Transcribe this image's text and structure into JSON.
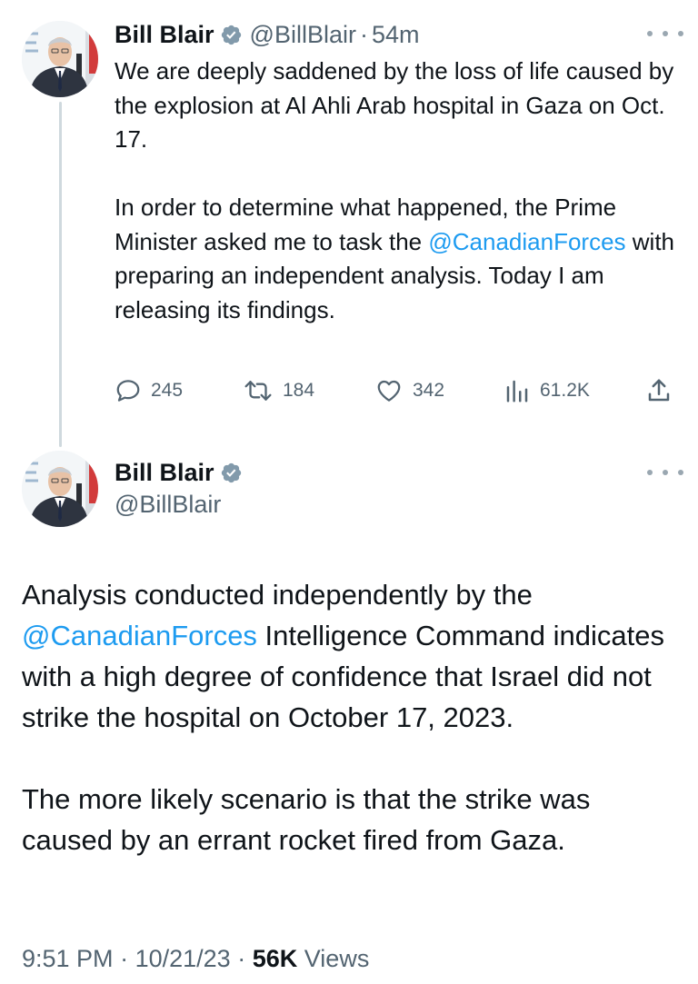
{
  "tweet1": {
    "display_name": "Bill Blair",
    "handle": "@BillBlair",
    "separator": "·",
    "time": "54m",
    "paragraph1": "We are deeply saddened by the loss of life caused by the explosion at Al Ahli Arab hospital in Gaza on Oct. 17.",
    "paragraph2_before": "In order to determine what happened, the Prime Minister asked me to task the ",
    "mention": "@CanadianForces",
    "paragraph2_after": " with preparing an independent analysis. Today I am releasing its findings.",
    "replies": "245",
    "reposts": "184",
    "likes": "342",
    "views": "61.2K"
  },
  "tweet2": {
    "display_name": "Bill Blair",
    "handle": "@BillBlair",
    "paragraph1_before": "Analysis conducted independently by the ",
    "mention": "@CanadianForces",
    "paragraph1_after": " Intelligence Command indicates with a high degree of confidence that Israel did not strike the hospital on October 17, 2023.",
    "paragraph2": "The more likely scenario is that the strike was caused by an errant rocket fired from Gaza.",
    "time": "9:51 PM",
    "separator": "·",
    "date": "10/21/23",
    "views_count": "56K",
    "views_label": "Views"
  },
  "icons": {
    "verified": "verified-badge-icon",
    "reply": "reply-icon",
    "repost": "repost-icon",
    "like": "heart-icon",
    "views": "analytics-icon",
    "share": "share-icon",
    "more": "more-icon"
  },
  "colors": {
    "link": "#1d9bf0",
    "secondary_text": "#536471",
    "verified_badge": "#829aab",
    "thread_line": "#cfd9de"
  }
}
